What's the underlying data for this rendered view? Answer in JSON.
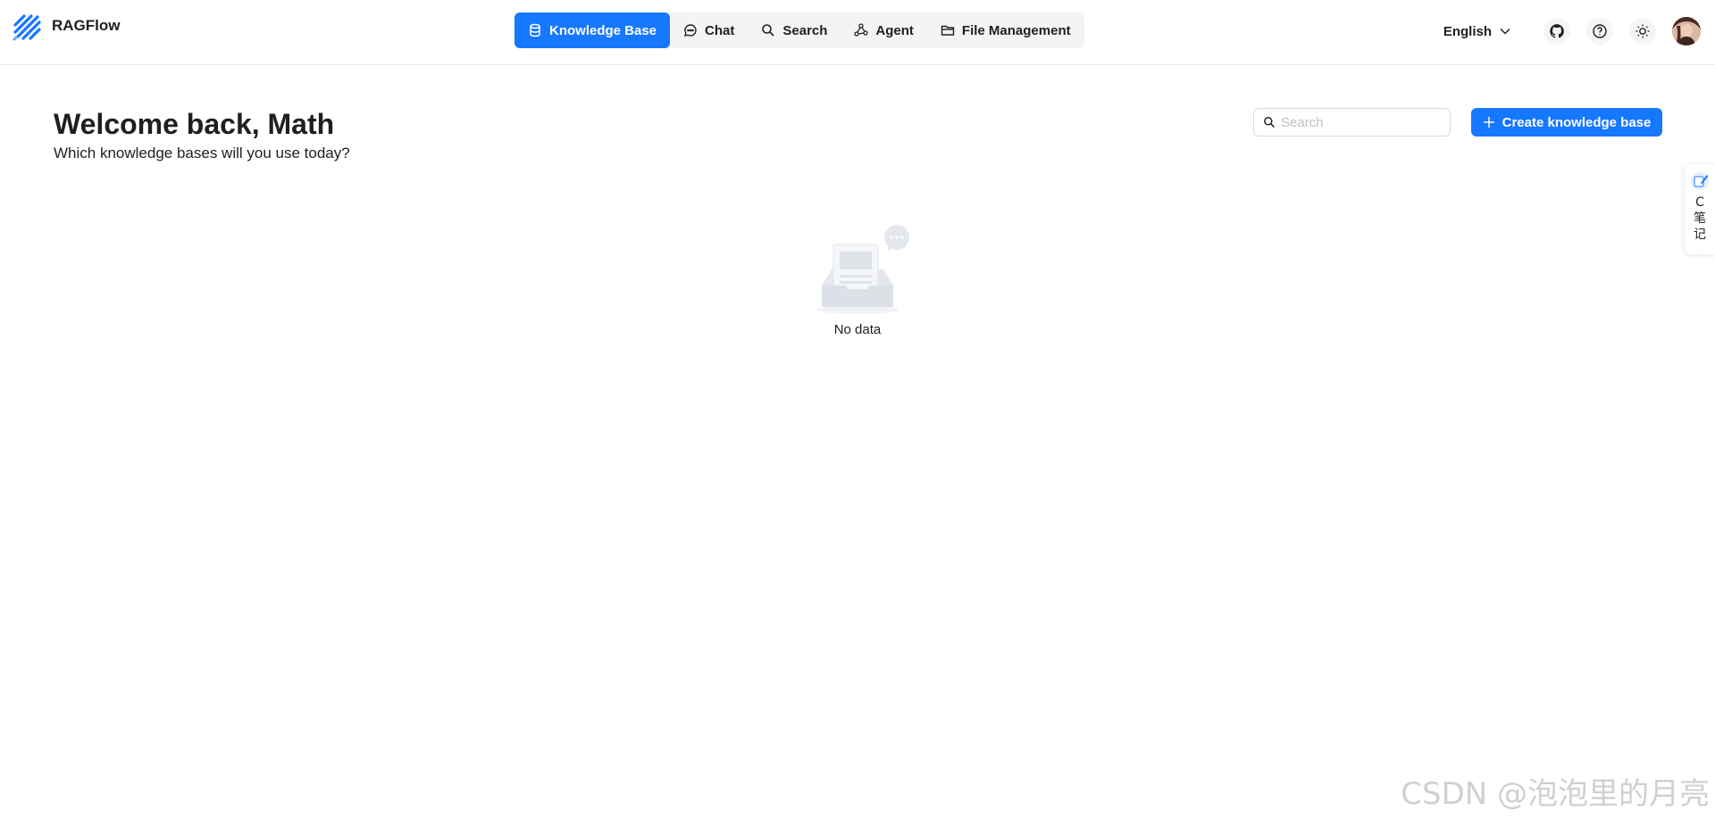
{
  "app": {
    "name": "RAGFlow"
  },
  "nav": {
    "items": [
      {
        "label": "Knowledge Base",
        "icon": "database-icon",
        "active": true
      },
      {
        "label": "Chat",
        "icon": "chat-bubble-icon",
        "active": false
      },
      {
        "label": "Search",
        "icon": "search-icon",
        "active": false
      },
      {
        "label": "Agent",
        "icon": "graph-icon",
        "active": false
      },
      {
        "label": "File Management",
        "icon": "folder-icon",
        "active": false
      }
    ]
  },
  "header_tools": {
    "language": "English",
    "github_icon": "github-icon",
    "help_icon": "help-icon",
    "theme_icon": "sun-icon"
  },
  "main": {
    "welcome": "Welcome back, Math",
    "subtitle": "Which knowledge bases will you use today?",
    "search_placeholder": "Search",
    "create_button": "Create knowledge base",
    "empty_text": "No data"
  },
  "float_widget": {
    "text": "C笔记"
  },
  "watermark": "CSDN @泡泡里的月亮",
  "colors": {
    "primary": "#1677ff",
    "nav_bg": "#f3f4f6",
    "text": "#1f1f1f"
  }
}
